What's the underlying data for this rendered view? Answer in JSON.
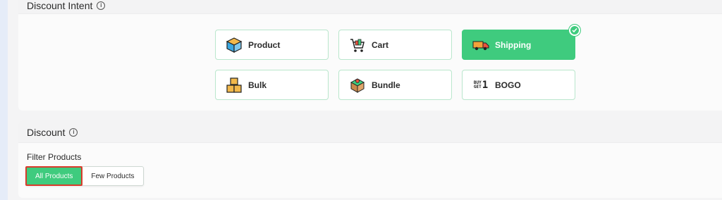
{
  "intent_section": {
    "title": "Discount Intent",
    "options": [
      {
        "label": "Product",
        "icon": "package-icon",
        "selected": false
      },
      {
        "label": "Cart",
        "icon": "shopping-cart-icon",
        "selected": false
      },
      {
        "label": "Shipping",
        "icon": "delivery-truck-icon",
        "selected": true
      },
      {
        "label": "Bulk",
        "icon": "stacked-boxes-icon",
        "selected": false
      },
      {
        "label": "Bundle",
        "icon": "bundle-box-icon",
        "selected": false
      },
      {
        "label": "BOGO",
        "icon": "buy-get-one-icon",
        "selected": false
      }
    ],
    "bogo_icon_text": {
      "top": "BUY",
      "bottom": "GET",
      "digit": "1"
    }
  },
  "discount_section": {
    "title": "Discount",
    "filter_label": "Filter Products",
    "filter_options": [
      "All Products",
      "Few Products"
    ],
    "selected_filter": "All Products"
  },
  "colors": {
    "accent": "#3fcb7e",
    "highlight_border": "#d93a2b"
  }
}
